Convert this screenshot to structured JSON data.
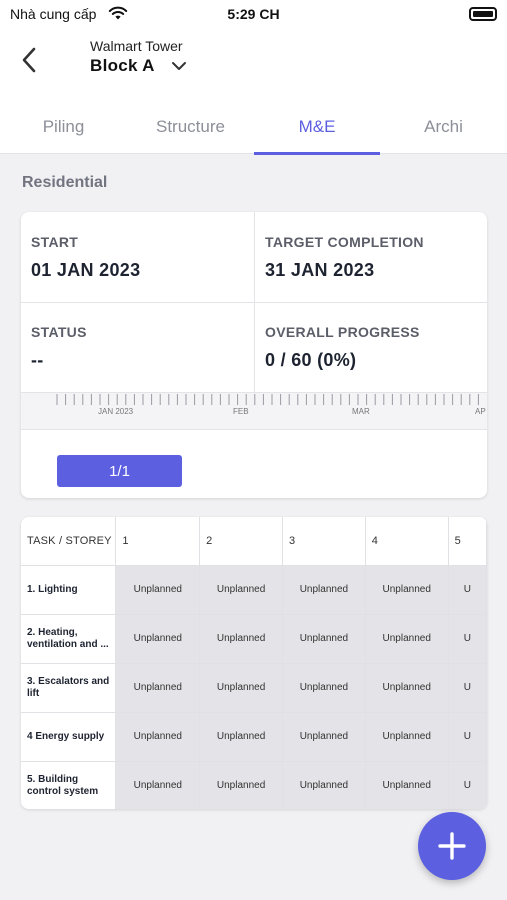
{
  "status_bar": {
    "carrier": "Nhà cung cấp",
    "time": "5:29 CH"
  },
  "header": {
    "project_name": "Walmart Tower",
    "block_name": "Block A"
  },
  "tabs": [
    {
      "label": "Piling",
      "active": false
    },
    {
      "label": "Structure",
      "active": false
    },
    {
      "label": "M&E",
      "active": true
    },
    {
      "label": "Archi",
      "active": false
    }
  ],
  "section_title": "Residential",
  "summary": {
    "start_label": "START",
    "start_value": "01 JAN 2023",
    "target_label": "TARGET COMPLETION",
    "target_value": "31 JAN 2023",
    "status_label": "STATUS",
    "status_value": "--",
    "progress_label": "OVERALL PROGRESS",
    "progress_value": "0 / 60 (0%)"
  },
  "timeline": {
    "labels": [
      "JAN 2023",
      "FEB",
      "MAR",
      "AP"
    ]
  },
  "pagination": {
    "label": "1/1"
  },
  "grid": {
    "corner_header": "TASK / STOREY",
    "storeys": [
      "1",
      "2",
      "3",
      "4",
      "5"
    ],
    "rows": [
      {
        "task": "1. Lighting",
        "cells": [
          "Unplanned",
          "Unplanned",
          "Unplanned",
          "Unplanned",
          "U"
        ]
      },
      {
        "task": "2. Heating, ventilation and ...",
        "cells": [
          "Unplanned",
          "Unplanned",
          "Unplanned",
          "Unplanned",
          "U"
        ]
      },
      {
        "task": "3. Escalators and lift",
        "cells": [
          "Unplanned",
          "Unplanned",
          "Unplanned",
          "Unplanned",
          "U"
        ]
      },
      {
        "task": "4 Energy supply",
        "cells": [
          "Unplanned",
          "Unplanned",
          "Unplanned",
          "Unplanned",
          "U"
        ]
      },
      {
        "task": "5. Building control system",
        "cells": [
          "Unplanned",
          "Unplanned",
          "Unplanned",
          "Unplanned",
          "U"
        ]
      }
    ]
  },
  "colors": {
    "accent": "#5b5fe0",
    "unplanned_cell": "#e4e4e8"
  },
  "icons": {
    "back": "chevron-left-icon",
    "dropdown": "chevron-down-icon",
    "fab": "plus-icon"
  }
}
